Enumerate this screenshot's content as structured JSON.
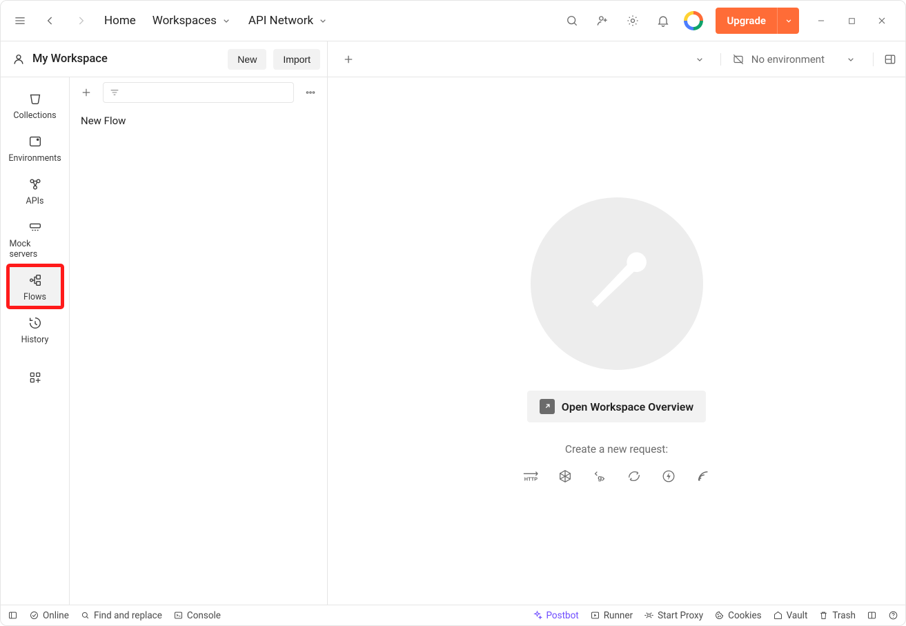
{
  "topnav": {
    "home": "Home",
    "workspaces": "Workspaces",
    "api_network": "API Network",
    "upgrade": "Upgrade"
  },
  "workspace": {
    "name": "My Workspace",
    "new_btn": "New",
    "import_btn": "Import",
    "environment": "No environment"
  },
  "rail": {
    "collections": "Collections",
    "environments": "Environments",
    "apis": "APIs",
    "mock_servers": "Mock servers",
    "flows": "Flows",
    "history": "History"
  },
  "list": {
    "items": [
      "New Flow"
    ]
  },
  "main": {
    "open_overview": "Open Workspace Overview",
    "create_hint": "Create a new request:"
  },
  "status": {
    "online": "Online",
    "find_replace": "Find and replace",
    "console": "Console",
    "postbot": "Postbot",
    "runner": "Runner",
    "start_proxy": "Start Proxy",
    "cookies": "Cookies",
    "vault": "Vault",
    "trash": "Trash"
  }
}
